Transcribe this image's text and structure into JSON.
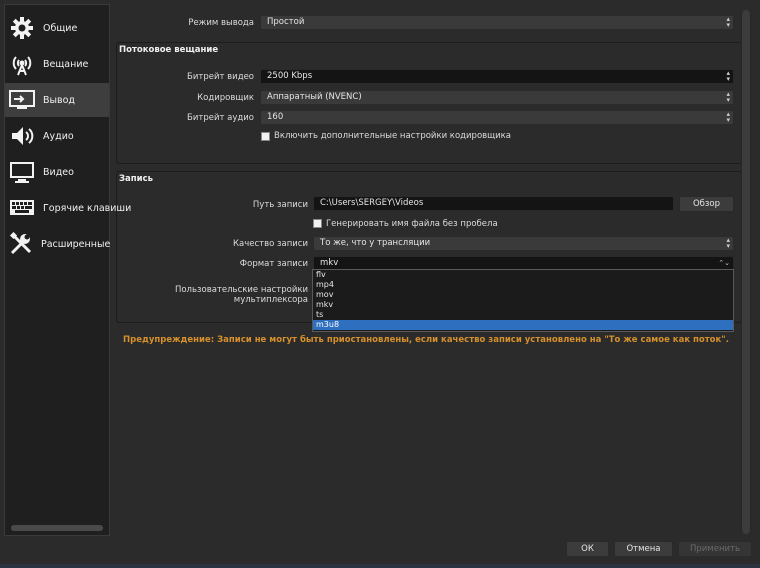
{
  "sidebar": {
    "items": [
      {
        "label": "Общие",
        "icon": "gear-icon"
      },
      {
        "label": "Вещание",
        "icon": "broadcast-icon"
      },
      {
        "label": "Вывод",
        "icon": "output-monitor-icon"
      },
      {
        "label": "Аудио",
        "icon": "speaker-icon"
      },
      {
        "label": "Видео",
        "icon": "monitor-icon"
      },
      {
        "label": "Горячие клавиши",
        "icon": "keyboard-icon"
      },
      {
        "label": "Расширенные",
        "icon": "tools-icon"
      }
    ],
    "active": "Вывод"
  },
  "output_mode": {
    "label": "Режим вывода",
    "value": "Простой"
  },
  "streaming": {
    "title": "Потоковое вещание",
    "video_bitrate": {
      "label": "Битрейт видео",
      "value": "2500 Kbps"
    },
    "encoder": {
      "label": "Кодировщик",
      "value": "Аппаратный (NVENC)"
    },
    "audio_bitrate": {
      "label": "Битрейт аудио",
      "value": "160"
    },
    "advanced_checkbox": {
      "label": "Включить дополнительные настройки кодировщика",
      "checked": false
    }
  },
  "recording": {
    "title": "Запись",
    "path": {
      "label": "Путь записи",
      "value": "C:\\Users\\SERGEY\\Videos"
    },
    "browse_label": "Обзор",
    "no_space": {
      "label": "Генерировать имя файла без пробела",
      "checked": false
    },
    "quality": {
      "label": "Качество записи",
      "value": "То же, что у трансляции"
    },
    "format": {
      "label": "Формат записи",
      "value": "mkv",
      "options": [
        "flv",
        "mp4",
        "mov",
        "mkv",
        "ts",
        "m3u8"
      ],
      "highlighted": "m3u8"
    },
    "muxer_label": "Пользовательские настройки мультиплексора"
  },
  "warning": "Предупреждение: Записи не могут быть приостановлены, если качество записи установлено на \"То же самое как поток\".",
  "buttons": {
    "ok": "ОК",
    "cancel": "Отмена",
    "apply": "Применить"
  },
  "colors": {
    "accent": "#2f6fbf",
    "warning": "#d6902c",
    "background": "#2b2b2b"
  }
}
